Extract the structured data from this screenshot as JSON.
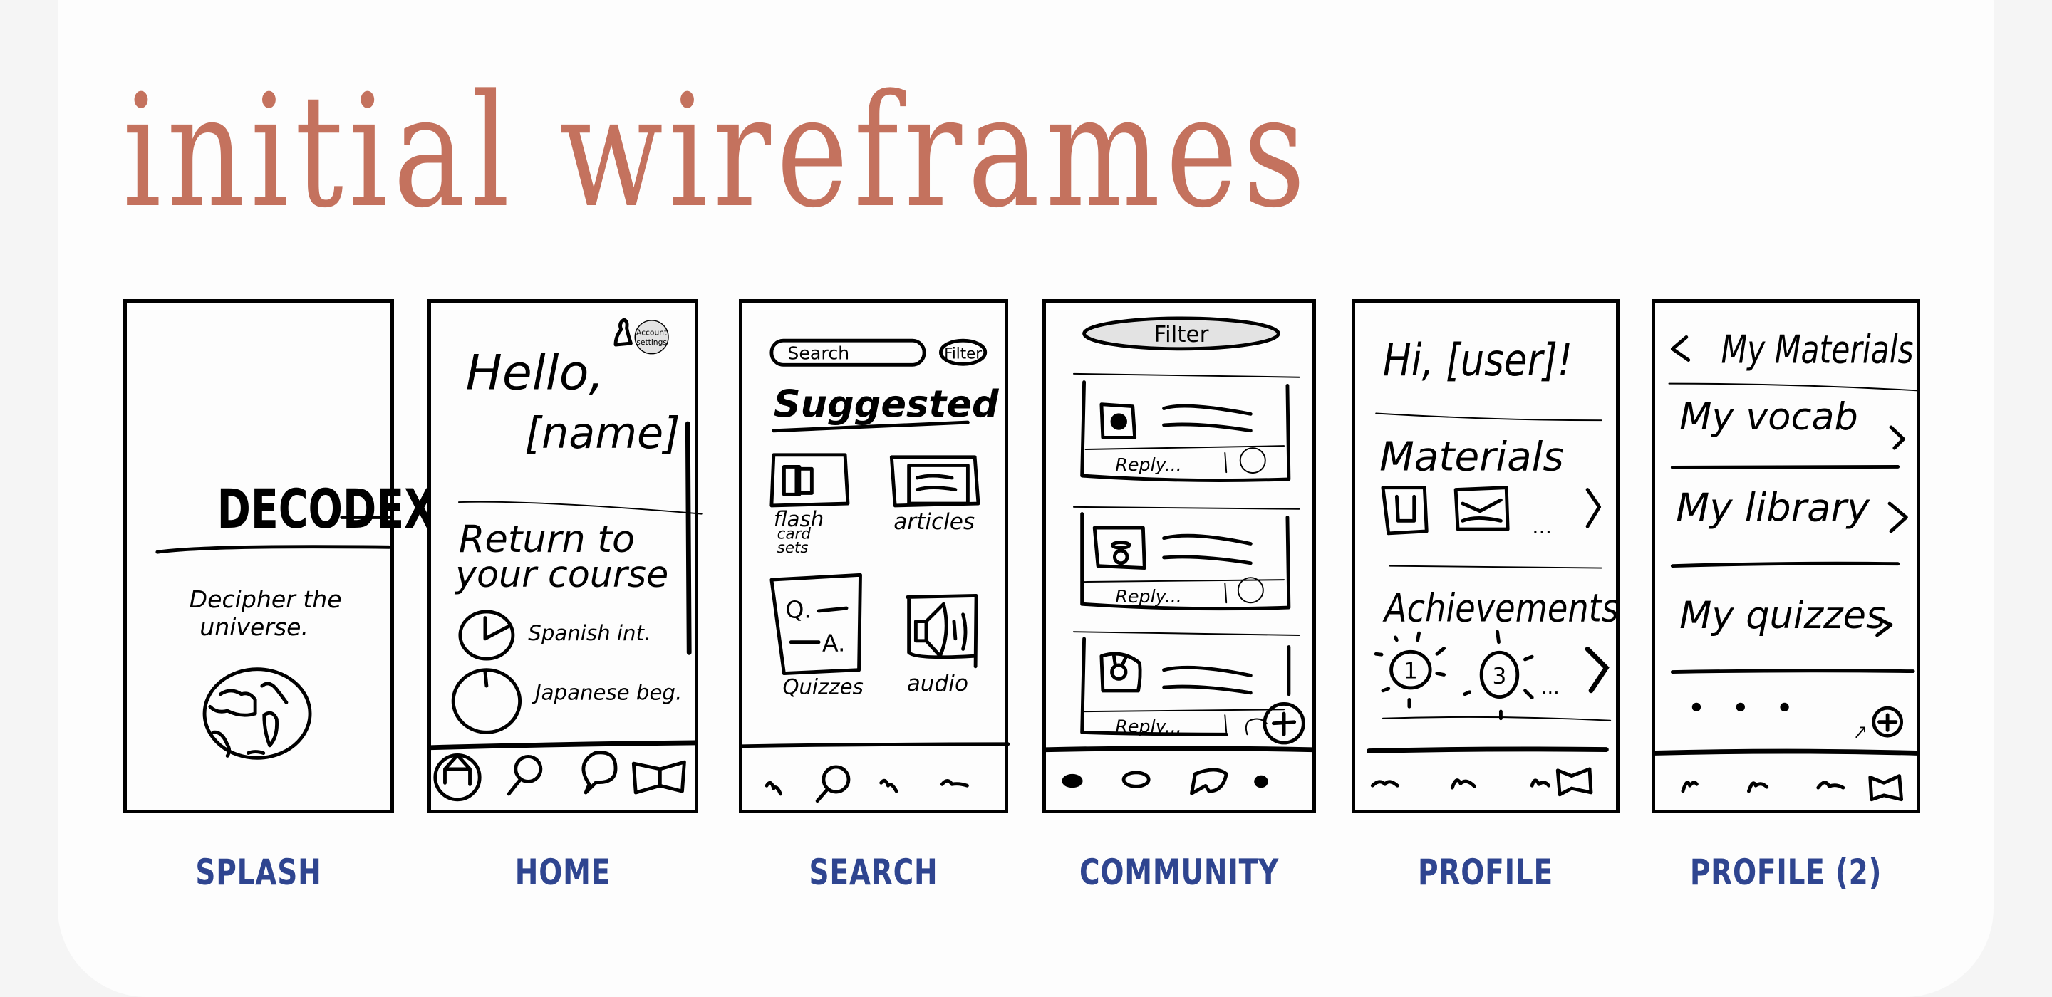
{
  "title": "initial wireframes",
  "colors": {
    "title": "#c4725e",
    "label": "#2f4590",
    "page_bg": "#f5f5f5",
    "card_bg": "#fdfdfd",
    "sketch": "#000000",
    "pill_fill": "#e3e3e3"
  },
  "frames": [
    {
      "label": "SPLASH",
      "logo": "DECODEX",
      "tagline_line1": "Decipher the",
      "tagline_line2": "universe.",
      "icons": [
        "globe-icon"
      ]
    },
    {
      "label": "HOME",
      "greeting_line1": "Hello,",
      "greeting_line2": "[name]",
      "account_button_line1": "Account",
      "account_button_line2": "settings",
      "section_line1": "Return to",
      "section_line2": "your course",
      "courses": [
        {
          "name": "Spanish int.",
          "progress": 0.25
        },
        {
          "name": "Japanese beg.",
          "progress": 0.03
        }
      ],
      "nav": [
        "home-icon",
        "search-icon",
        "chat-bubble-icon",
        "book-icon"
      ],
      "icons": [
        "bell-icon"
      ]
    },
    {
      "label": "SEARCH",
      "search_placeholder": "Search",
      "filter_label": "Filter",
      "section": "Suggested",
      "categories": [
        {
          "name_line1": "flash",
          "name_line2": "card",
          "name_line3": "sets",
          "icon": "flashcards-icon"
        },
        {
          "name_line1": "articles",
          "icon": "article-icon"
        },
        {
          "name_line1": "Quizzes",
          "icon": "quiz-icon",
          "q": "Q.",
          "a": "A."
        },
        {
          "name_line1": "audio",
          "icon": "speaker-icon"
        }
      ]
    },
    {
      "label": "COMMUNITY",
      "filter_label": "Filter",
      "posts": [
        {
          "avatar": "bear-avatar-icon",
          "reply_placeholder": "Reply..."
        },
        {
          "avatar": "snowman-avatar-icon",
          "reply_placeholder": "Reply..."
        },
        {
          "avatar": "bunny-avatar-icon",
          "reply_placeholder": "Reply..."
        }
      ],
      "fab": "plus-icon"
    },
    {
      "label": "PROFILE",
      "greeting": "Hi, [user]!",
      "materials_heading": "Materials",
      "materials_more": "...",
      "achievements_heading": "Achievements",
      "achievements": [
        "1",
        "3"
      ],
      "achievements_more": "..."
    },
    {
      "label": "PROFILE (2)",
      "header": "My Materials",
      "items": [
        "My vocab",
        "My library",
        "My quizzes"
      ],
      "more": "• • •",
      "fab": "plus-icon"
    }
  ]
}
